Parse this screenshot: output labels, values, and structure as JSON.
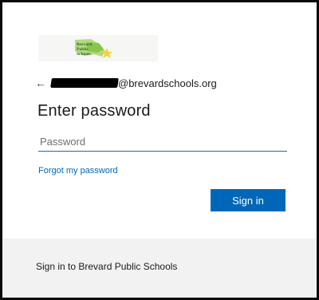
{
  "logo": {
    "text_lines": [
      "Brevard",
      "Public",
      "Schools"
    ],
    "colors": {
      "green": "#7fbf3f",
      "yellow": "#f2d43b",
      "text": "#2d6a2d"
    }
  },
  "identity": {
    "back_icon": "back-arrow-icon",
    "email_domain": "@brevardschools.org"
  },
  "page_title": "Enter password",
  "password_field": {
    "placeholder": "Password",
    "value": ""
  },
  "forgot_link": "Forgot my password",
  "signin_button": "Sign in",
  "footer_text": "Sign in to Brevard Public Schools",
  "colors": {
    "accent": "#0067b8",
    "input_underline": "#0f6cbd",
    "footer_bg": "#f2f2f2",
    "frame_border": "#0a0a0a"
  }
}
